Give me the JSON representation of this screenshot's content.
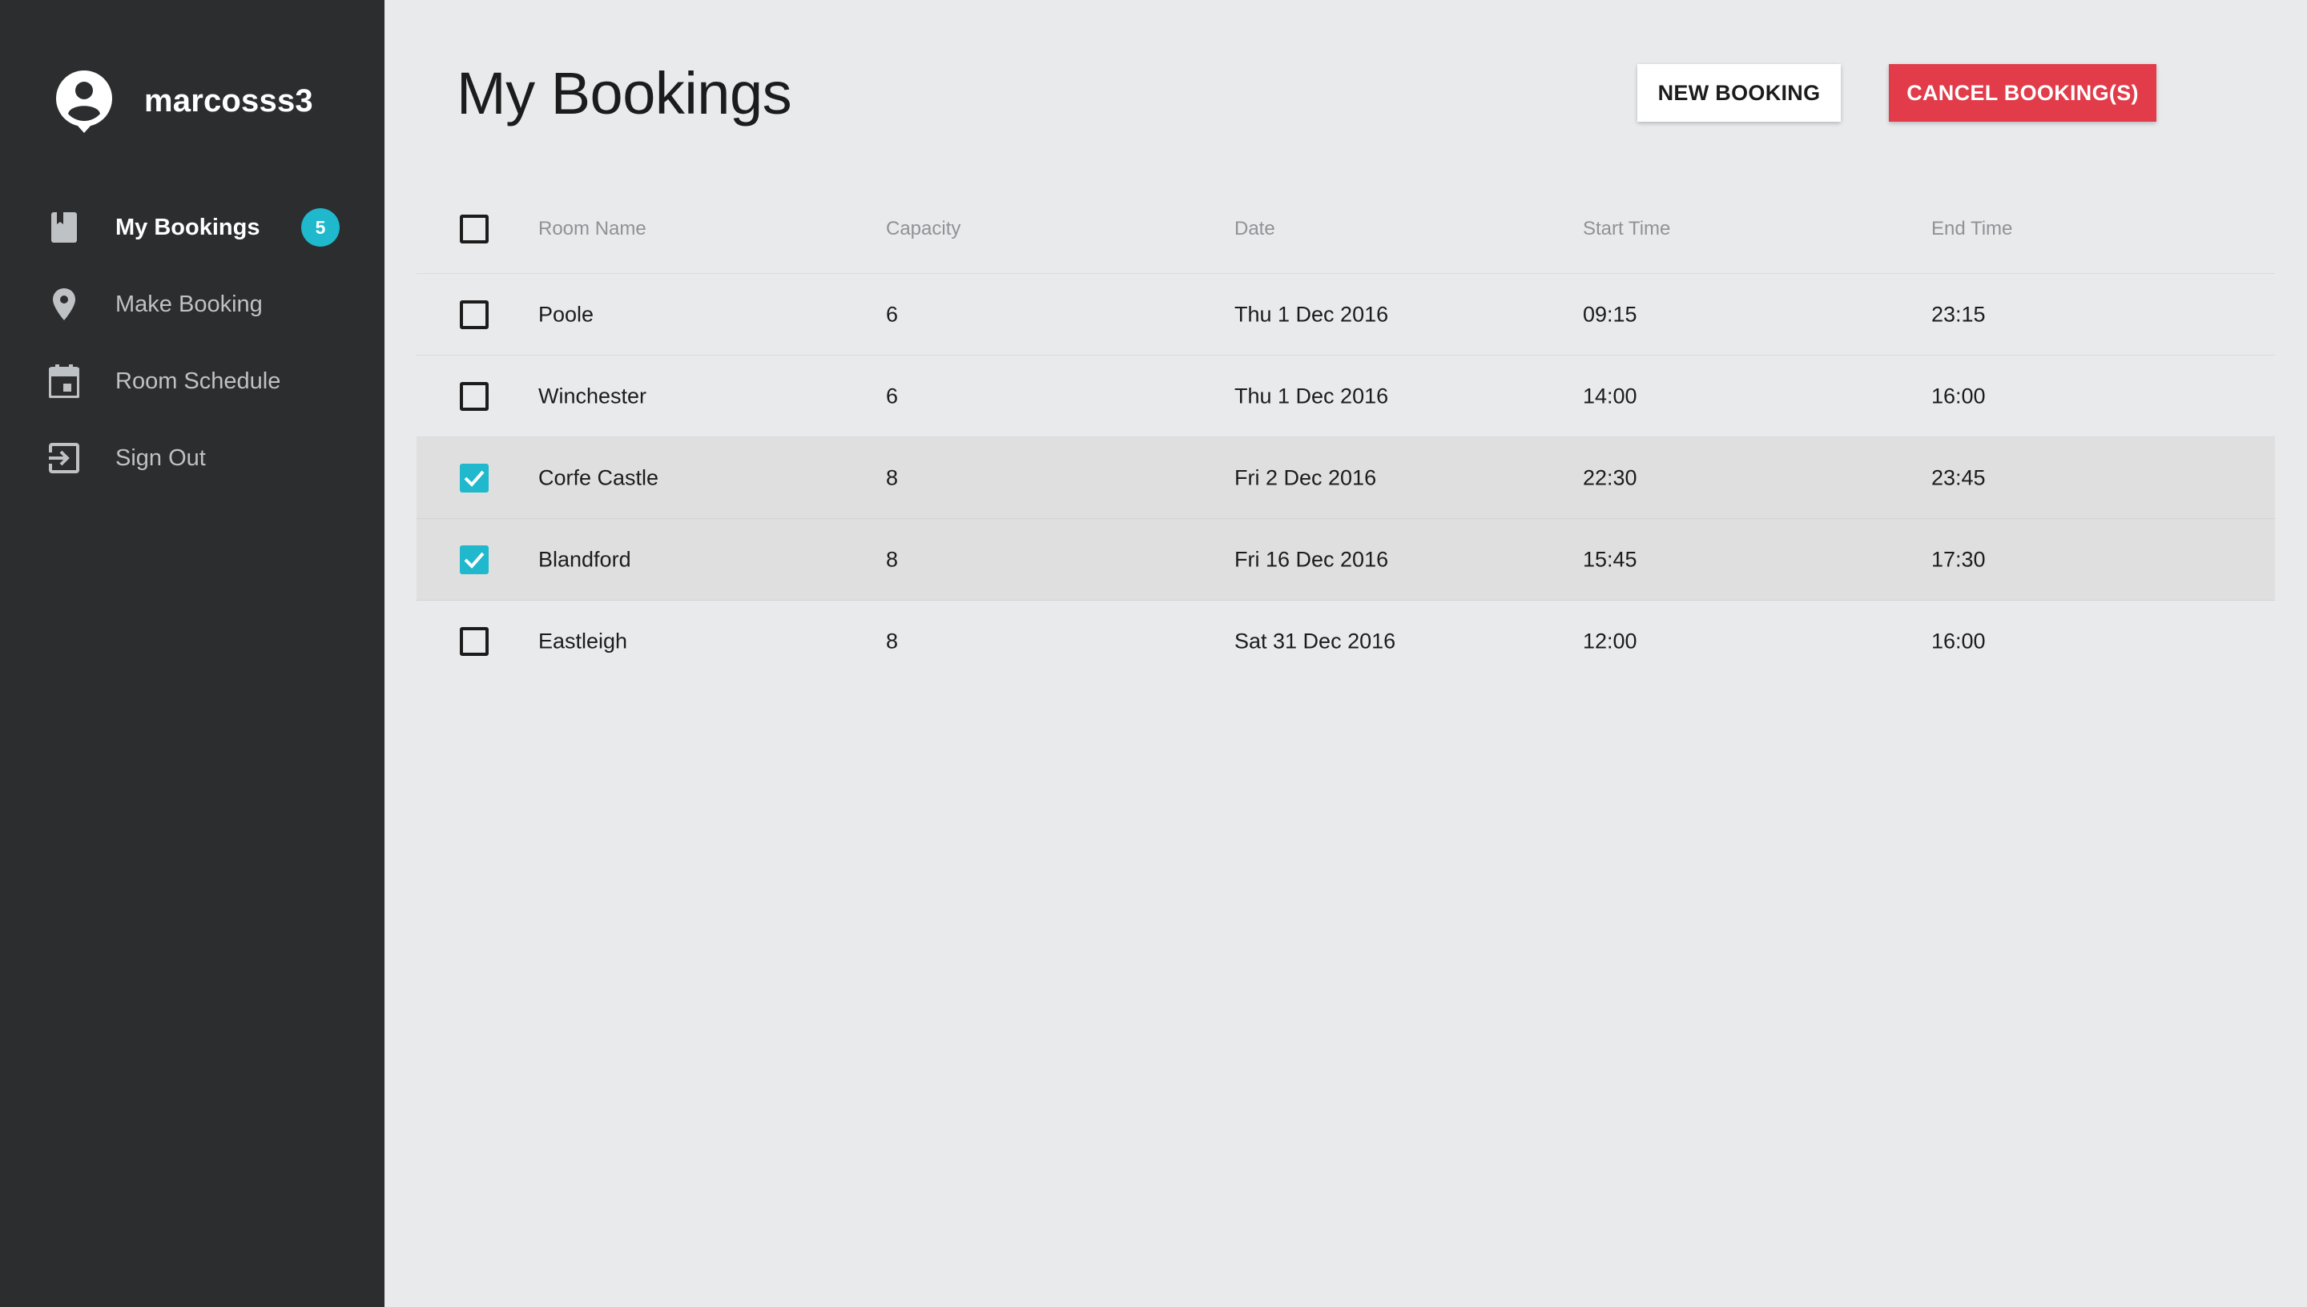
{
  "user": {
    "name": "marcosss3",
    "avatar_icon": "account-circle-icon"
  },
  "nav": {
    "items": [
      {
        "label": "My Bookings",
        "icon": "book-icon",
        "active": true,
        "badge": "5"
      },
      {
        "label": "Make Booking",
        "icon": "map-pin-icon",
        "active": false
      },
      {
        "label": "Room Schedule",
        "icon": "calendar-icon",
        "active": false
      },
      {
        "label": "Sign Out",
        "icon": "sign-out-icon",
        "active": false
      }
    ]
  },
  "page": {
    "title": "My Bookings"
  },
  "actions": {
    "new_label": "NEW BOOKING",
    "cancel_label": "CANCEL BOOKING(S)"
  },
  "table": {
    "columns": [
      "Room Name",
      "Capacity",
      "Date",
      "Start Time",
      "End Time"
    ],
    "select_all_checked": false,
    "rows": [
      {
        "room": "Poole",
        "capacity": "6",
        "date": "Thu 1 Dec 2016",
        "start": "09:15",
        "end": "23:15",
        "checked": false
      },
      {
        "room": "Winchester",
        "capacity": "6",
        "date": "Thu 1 Dec 2016",
        "start": "14:00",
        "end": "16:00",
        "checked": false
      },
      {
        "room": "Corfe Castle",
        "capacity": "8",
        "date": "Fri 2 Dec 2016",
        "start": "22:30",
        "end": "23:45",
        "checked": true
      },
      {
        "room": "Blandford",
        "capacity": "8",
        "date": "Fri 16 Dec 2016",
        "start": "15:45",
        "end": "17:30",
        "checked": true
      },
      {
        "room": "Eastleigh",
        "capacity": "8",
        "date": "Sat 31 Dec 2016",
        "start": "12:00",
        "end": "16:00",
        "checked": false
      }
    ]
  },
  "colors": {
    "sidebar_bg": "#2b2d2f",
    "content_bg": "#e8eaec",
    "accent": "#1fb8cc",
    "danger": "#e23c4b",
    "selected_row": "#dfdfdf"
  }
}
